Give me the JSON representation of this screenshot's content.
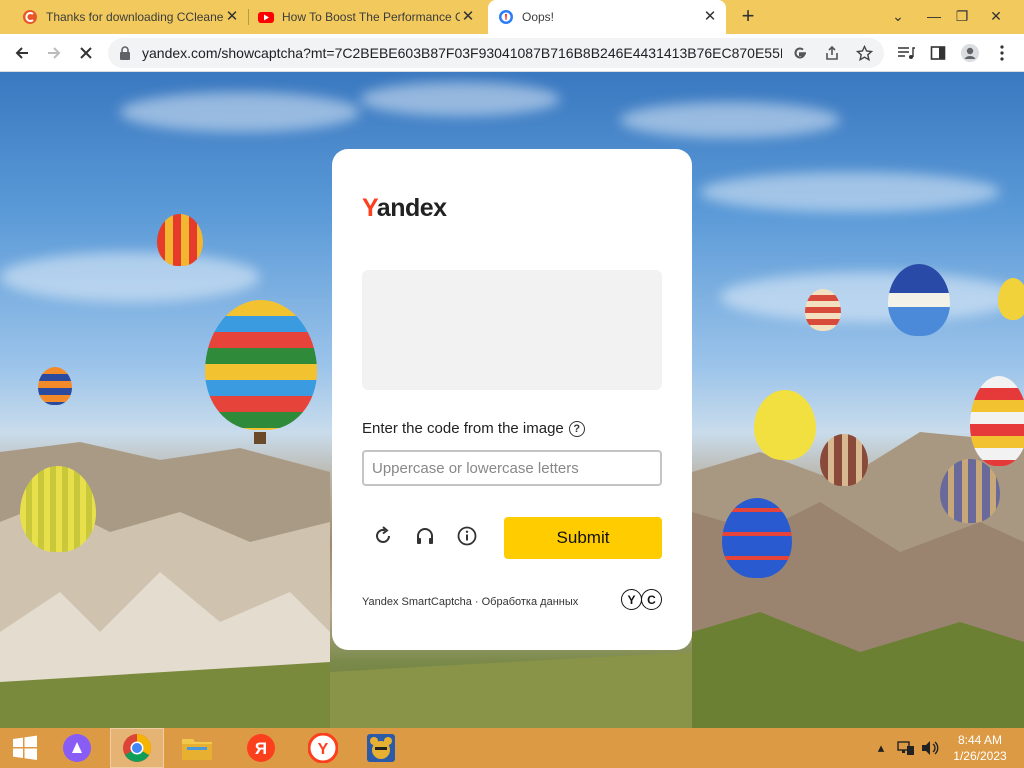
{
  "browser": {
    "tabs": [
      {
        "title": "Thanks for downloading CCleaner",
        "icon": "ccleaner-icon",
        "active": false
      },
      {
        "title": "How To Boost The Performance Of",
        "icon": "youtube-icon",
        "active": false
      },
      {
        "title": "Oops!",
        "icon": "yandex-browser-icon",
        "active": true
      }
    ],
    "address": "yandex.com/showcaptcha?mt=7C2BEBE603B87F03F93041087B716B8B246E4431413B76EC870E55B36…",
    "colors": {
      "tabstrip": "#f1c95d",
      "toolbar": "#ffffff"
    }
  },
  "captcha": {
    "logo_first": "Y",
    "logo_rest": "andex",
    "prompt": "Enter the code from the image",
    "input_placeholder": "Uppercase or lowercase letters",
    "input_value": "",
    "submit_label": "Submit",
    "footer": "Yandex SmartCaptcha · Обработка данных",
    "footer_logo": [
      "Y",
      "C"
    ],
    "accent": "#ffcc00"
  },
  "taskbar": {
    "time": "8:44 AM",
    "date": "1/26/2023",
    "apps": [
      "windows-start",
      "alice-assistant",
      "chrome",
      "file-explorer",
      "yandex-browser-orange",
      "yandex-browser",
      "bear-app"
    ]
  }
}
